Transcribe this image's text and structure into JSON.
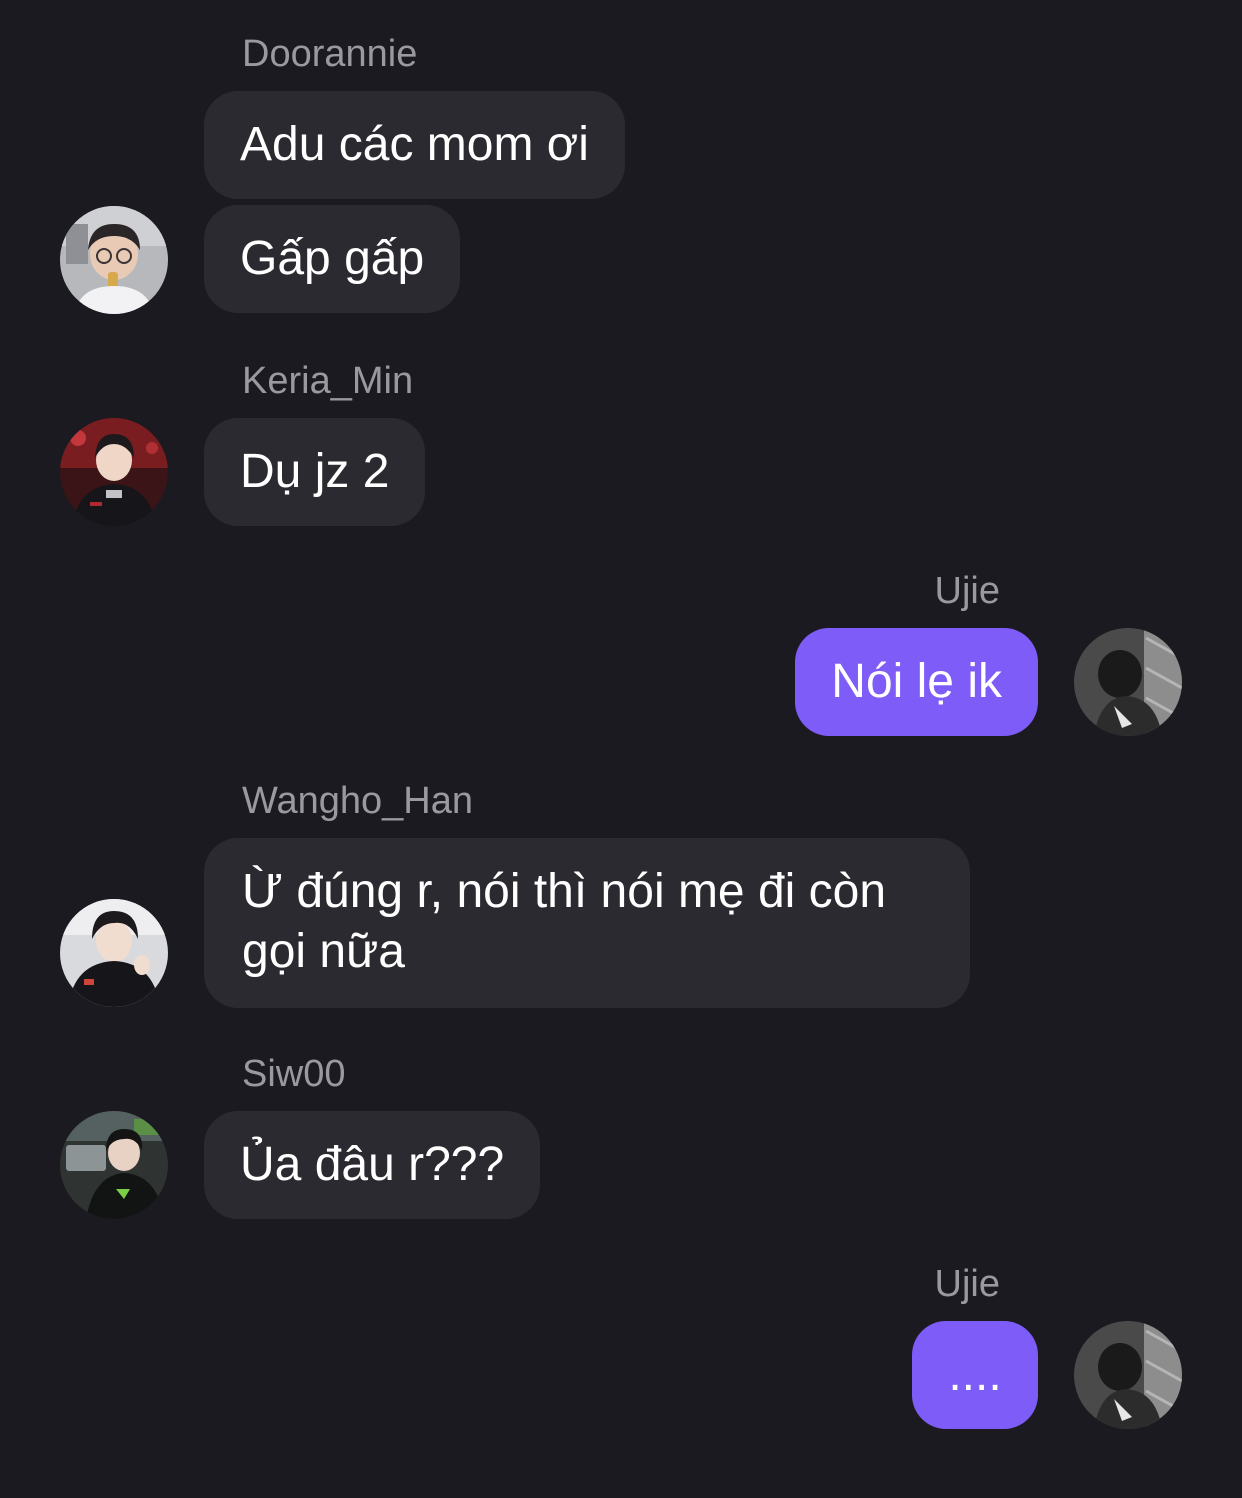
{
  "messages": [
    {
      "sender": "Doorannie",
      "bubbles": [
        "Adu các mom ơi",
        "Gấp gấp"
      ],
      "avatar": "avatar-doorannie"
    },
    {
      "sender": "Keria_Min",
      "bubbles": [
        "Dụ jz 2"
      ],
      "avatar": "avatar-keria-min"
    },
    {
      "sender": "Ujie",
      "bubbles": [
        "Nói lẹ ik"
      ],
      "avatar": "avatar-ujie",
      "mine": true
    },
    {
      "sender": "Wangho_Han",
      "bubbles": [
        "Ừ đúng r, nói thì nói mẹ đi còn gọi nữa"
      ],
      "avatar": "avatar-wangho-han"
    },
    {
      "sender": "Siw00",
      "bubbles": [
        "Ủa đâu r???"
      ],
      "avatar": "avatar-siw00"
    },
    {
      "sender": "Ujie",
      "bubbles": [
        "...."
      ],
      "avatar": "avatar-ujie",
      "mine": true
    }
  ],
  "colors": {
    "background": "#1b1a20",
    "incoming_bubble": "#2b2a30",
    "outgoing_bubble": "#7e5cf7",
    "sender_name": "#9a999f",
    "message_text": "#ffffff"
  }
}
